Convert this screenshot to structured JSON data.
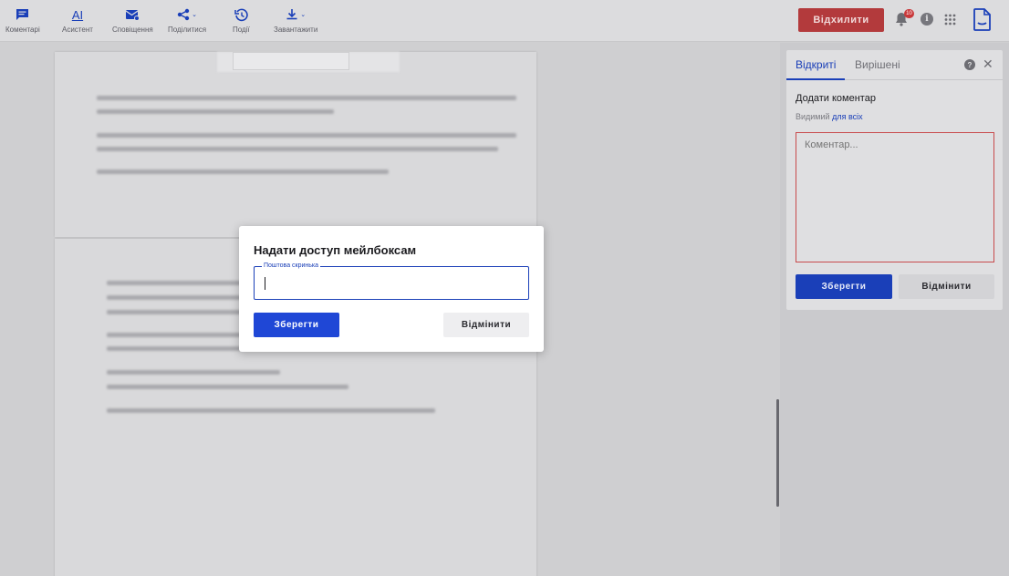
{
  "toolbar": {
    "tools": [
      {
        "label": "Коментарі",
        "icon": "comment-icon"
      },
      {
        "label": "Асистент",
        "icon": "ai-icon",
        "glyph": "AI"
      },
      {
        "label": "Сповіщення",
        "icon": "mail-notify-icon"
      },
      {
        "label": "Поділитися",
        "icon": "share-icon"
      },
      {
        "label": "Події",
        "icon": "history-icon"
      },
      {
        "label": "Завантажити",
        "icon": "download-icon"
      }
    ],
    "reject_label": "Відхилити",
    "notification_count": "10",
    "info_glyph": "i"
  },
  "right_panel": {
    "tabs": [
      {
        "label": "Відкриті",
        "active": true
      },
      {
        "label": "Вирішені",
        "active": false
      }
    ],
    "help_glyph": "?",
    "close_glyph": "✕",
    "add_comment_title": "Додати коментар",
    "visible_prefix": "Видимий",
    "visible_link": "для всіх",
    "comment_placeholder": "Коментар...",
    "save_label": "Зберегти",
    "cancel_label": "Відмінити"
  },
  "modal": {
    "title": "Надати доступ мейлбоксам",
    "field_label": "Поштова скринька",
    "field_value": "",
    "save_label": "Зберегти",
    "cancel_label": "Відмінити"
  },
  "colors": {
    "accent": "#1a3fb8",
    "reject": "#b33a3c",
    "overlay_background": "#cfcfd1"
  }
}
